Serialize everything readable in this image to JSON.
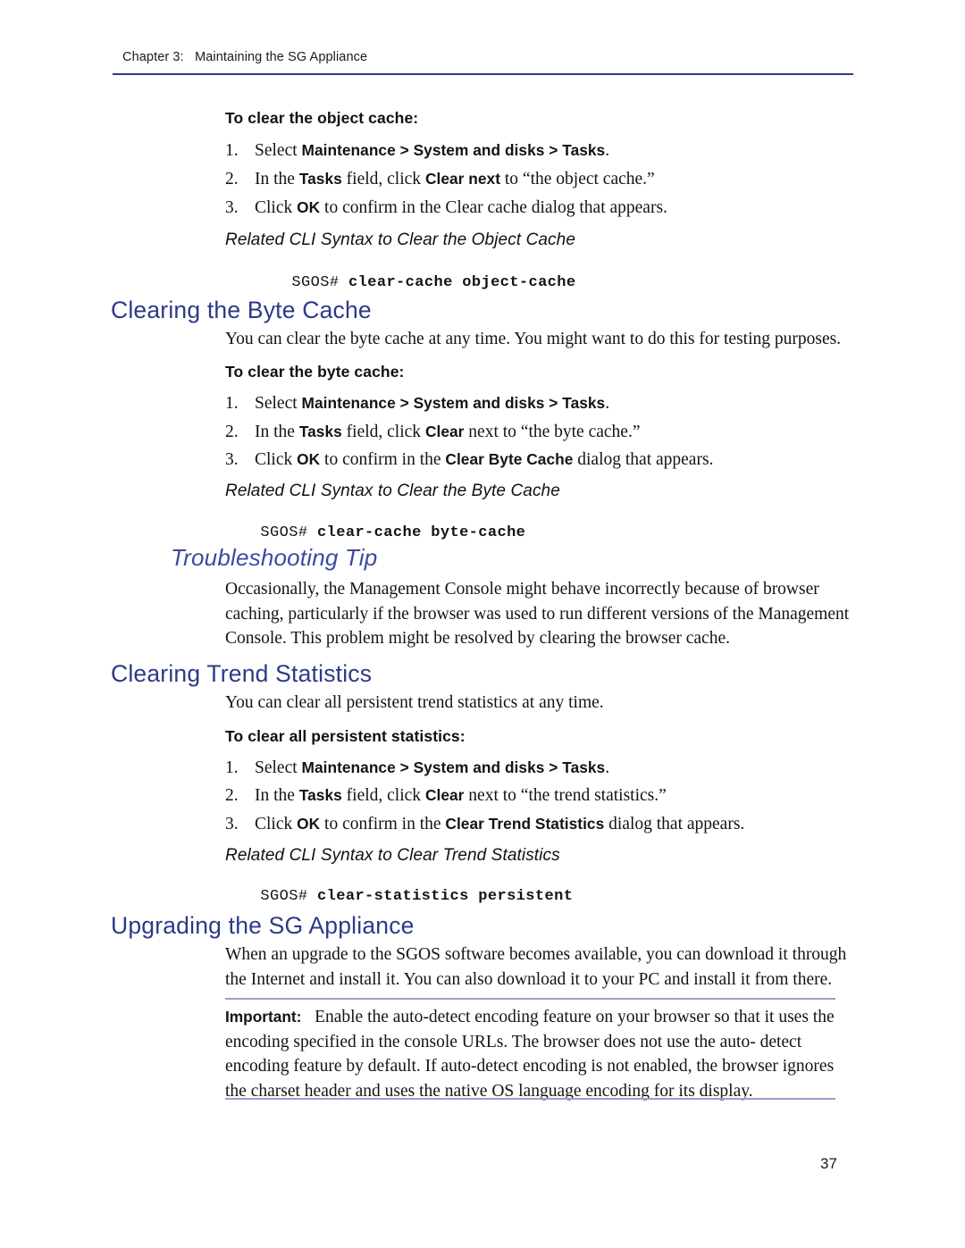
{
  "header": {
    "chapter_label": "Chapter 3:",
    "chapter_title": "Maintaining the SG Appliance",
    "full_text": "Chapter 3:   Maintaining the SG Appliance",
    "rule_color": "#2e3a87"
  },
  "colors": {
    "heading_blue": "#2e3a87",
    "italic_heading_blue": "#3a4aa0",
    "callout_rule": "#9aa0c8",
    "body_text": "#141414"
  },
  "sections": {
    "object_cache": {
      "lead_in": "To clear the object cache:",
      "steps": [
        {
          "num": "1.",
          "parts": [
            {
              "t": "Select ",
              "b": false
            },
            {
              "t": "Maintenance > System and disks > Tasks",
              "b": true
            },
            {
              "t": ".",
              "b": false
            }
          ]
        },
        {
          "num": "2.",
          "parts": [
            {
              "t": "In the ",
              "b": false
            },
            {
              "t": "Tasks",
              "b": true
            },
            {
              "t": " field, click ",
              "b": false
            },
            {
              "t": "Clear next",
              "b": true
            },
            {
              "t": " to “the object cache.”",
              "b": false
            }
          ]
        },
        {
          "num": "3.",
          "parts": [
            {
              "t": "Click ",
              "b": false
            },
            {
              "t": "OK",
              "b": true
            },
            {
              "t": " to confirm in the Clear cache dialog that appears.",
              "b": false
            }
          ]
        }
      ],
      "cli_title": "Related CLI Syntax to Clear the Object Cache",
      "cli_prompt": "SGOS# ",
      "cli_command": "clear-cache object-cache"
    },
    "byte_cache": {
      "heading": "Clearing the Byte Cache",
      "intro": "You can clear the byte cache at any time. You might want to do this for testing purposes.",
      "lead_in": "To clear the byte cache:",
      "steps": [
        {
          "num": "1.",
          "parts": [
            {
              "t": "Select ",
              "b": false
            },
            {
              "t": "Maintenance > System and disks > Tasks",
              "b": true
            },
            {
              "t": ".",
              "b": false
            }
          ]
        },
        {
          "num": "2.",
          "parts": [
            {
              "t": "In the ",
              "b": false
            },
            {
              "t": "Tasks",
              "b": true
            },
            {
              "t": " field, click ",
              "b": false
            },
            {
              "t": "Clear",
              "b": true
            },
            {
              "t": " next to “the byte cache.”",
              "b": false
            }
          ]
        },
        {
          "num": "3.",
          "parts": [
            {
              "t": "Click ",
              "b": false
            },
            {
              "t": "OK",
              "b": true
            },
            {
              "t": " to confirm in the ",
              "b": false
            },
            {
              "t": "Clear Byte Cache",
              "b": true
            },
            {
              "t": " dialog that appears.",
              "b": false
            }
          ]
        }
      ],
      "cli_title": "Related CLI Syntax to Clear the Byte Cache",
      "cli_prompt": "SGOS# ",
      "cli_command": "clear-cache byte-cache"
    },
    "troubleshooting": {
      "heading": "Troubleshooting Tip",
      "paragraph": "Occasionally, the Management Console might behave incorrectly because of browser caching, particularly if the browser was used to run different versions of the Management Console. This problem might be resolved by clearing the browser cache."
    },
    "trend_statistics": {
      "heading": "Clearing Trend Statistics",
      "intro": "You can clear all persistent trend statistics at any time.",
      "lead_in": "To clear all persistent statistics:",
      "steps": [
        {
          "num": "1.",
          "parts": [
            {
              "t": "Select ",
              "b": false
            },
            {
              "t": "Maintenance > System and disks > Tasks",
              "b": true
            },
            {
              "t": ".",
              "b": false
            }
          ]
        },
        {
          "num": "2.",
          "parts": [
            {
              "t": "In the ",
              "b": false
            },
            {
              "t": "Tasks",
              "b": true
            },
            {
              "t": " field, click ",
              "b": false
            },
            {
              "t": "Clear",
              "b": true
            },
            {
              "t": " next to “the trend statistics.”",
              "b": false
            }
          ]
        },
        {
          "num": "3.",
          "parts": [
            {
              "t": "Click ",
              "b": false
            },
            {
              "t": "OK",
              "b": true
            },
            {
              "t": " to confirm in the ",
              "b": false
            },
            {
              "t": "Clear Trend Statistics",
              "b": true
            },
            {
              "t": " dialog that appears.",
              "b": false
            }
          ]
        }
      ],
      "cli_title": "Related CLI Syntax to Clear Trend Statistics",
      "cli_prompt": "SGOS# ",
      "cli_command": "clear-statistics persistent"
    },
    "upgrading": {
      "heading": "Upgrading the SG Appliance",
      "paragraph": "When an upgrade to the SGOS software becomes available, you can download it through the Internet and install it. You can also download it to your PC and install it from there."
    },
    "important_callout": {
      "label": "Important:",
      "text": "Enable the auto-detect encoding feature on your browser so that it uses the encoding specified in the console URLs. The browser does not use the auto- detect encoding feature by default. If auto-detect encoding is not enabled, the browser ignores the charset header and uses the native OS language encoding for its display."
    }
  },
  "footer": {
    "page_number": "37"
  }
}
